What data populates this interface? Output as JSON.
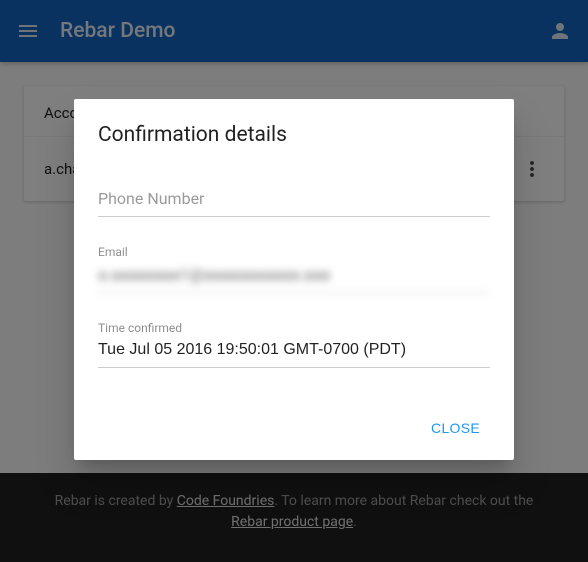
{
  "header": {
    "title": "Rebar Demo"
  },
  "card": {
    "header_prefix": "Acco",
    "row_prefix": "a.cha"
  },
  "footer": {
    "text1": "Rebar is created by ",
    "link1": "Code Foundries",
    "text2": ". To learn more about Rebar check out the ",
    "link2": "Rebar product page",
    "text3": "."
  },
  "dialog": {
    "title": "Confirmation details",
    "phone_label": "Phone Number",
    "email_label": "Email",
    "email_value": "a.aaaaaaaa1@aaaaaaaaaaa.aaa",
    "time_label": "Time confirmed",
    "time_value": "Tue Jul 05 2016 19:50:01 GMT-0700 (PDT)",
    "close_label": "CLOSE"
  }
}
